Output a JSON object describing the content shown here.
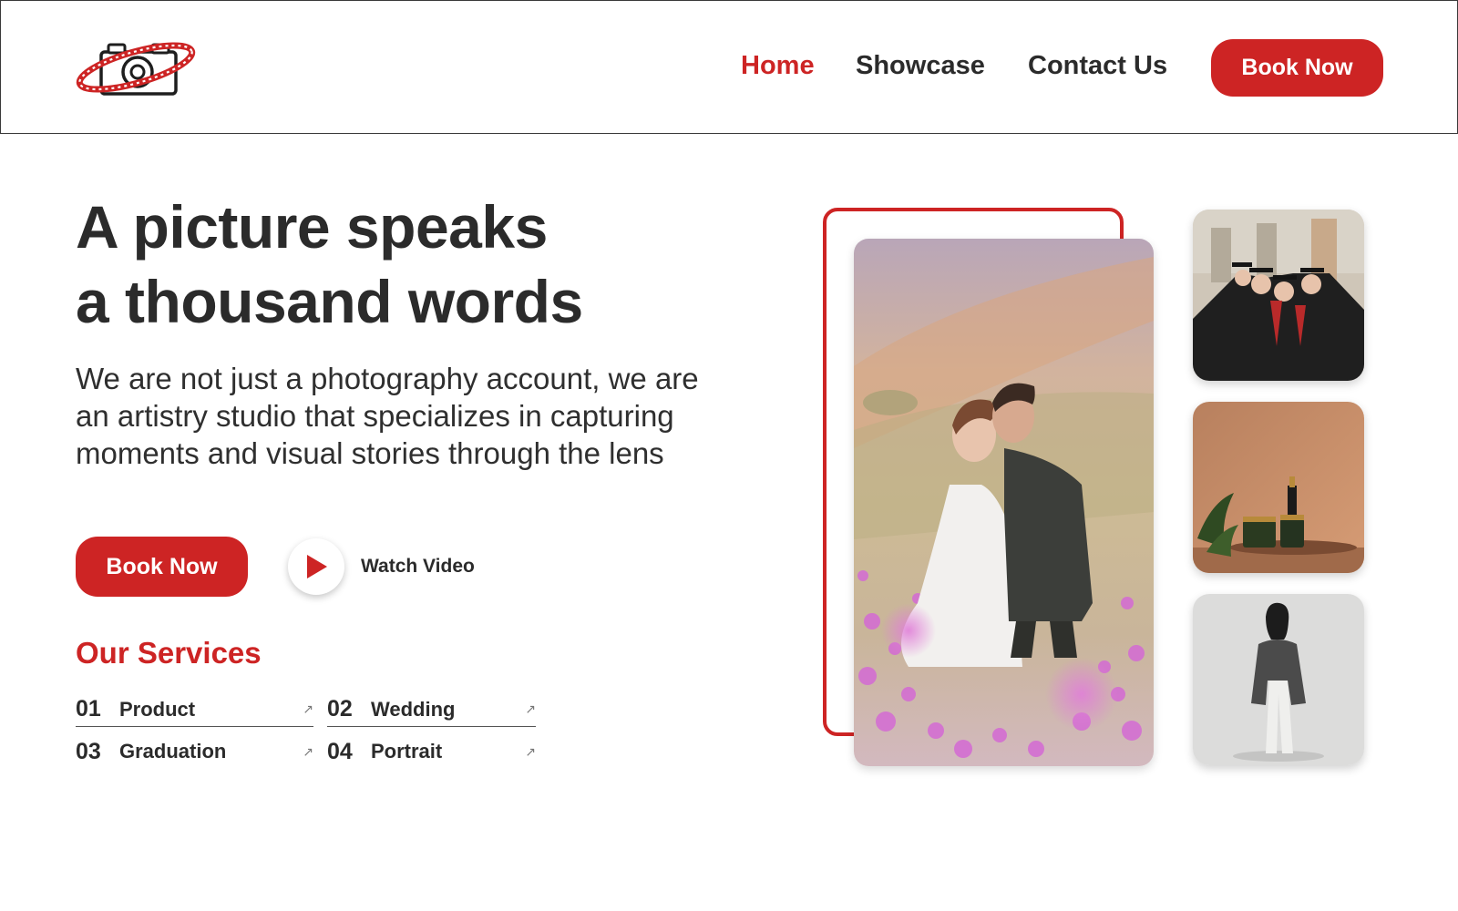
{
  "nav": {
    "home": "Home",
    "showcase": "Showcase",
    "contact": "Contact Us",
    "book": "Book Now"
  },
  "hero": {
    "title_line1": "A picture speaks",
    "title_line2": "a thousand words",
    "description": "We are not just a photography account, we are an artistry studio that specializes in capturing moments and visual stories through the lens",
    "book": "Book Now",
    "watch": "Watch Video"
  },
  "services": {
    "title": "Our Services",
    "items": [
      {
        "num": "01",
        "name": "Product",
        "arrow": "↗"
      },
      {
        "num": "02",
        "name": "Wedding",
        "arrow": "↗"
      },
      {
        "num": "03",
        "name": "Graduation",
        "arrow": "↗"
      },
      {
        "num": "04",
        "name": "Portrait",
        "arrow": "↗"
      }
    ]
  },
  "icons": {
    "logo": "camera-orbit-logo-icon",
    "play": "play-icon",
    "arrow": "arrow-up-right-icon"
  },
  "colors": {
    "accent": "#cd2424",
    "text": "#2b2b2b"
  }
}
